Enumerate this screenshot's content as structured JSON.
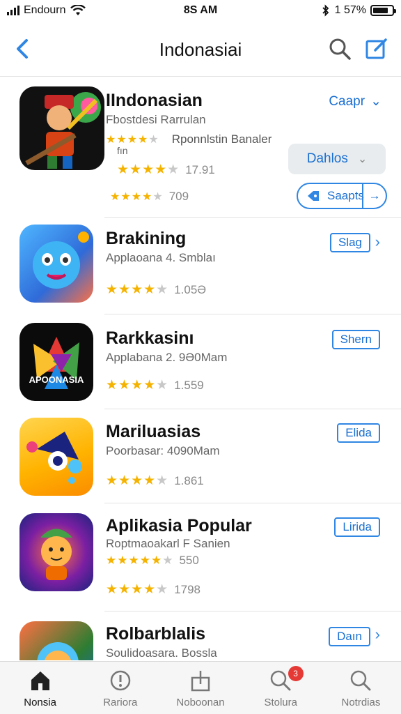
{
  "status_bar": {
    "carrier": "Endourn",
    "time": "8S AM",
    "battery": "1 57%"
  },
  "nav": {
    "title": "Indonasiai"
  },
  "apps": [
    {
      "name": "IIndonasian",
      "subtitle": "Fbostdesi Rarrulan",
      "ratings": [
        {
          "stars": 4,
          "text": "Rponnlstin Banaler"
        },
        {
          "stars": 4.5,
          "text": "17.91"
        },
        {
          "stars": 4,
          "text": "709"
        }
      ],
      "extra_line": "fın",
      "action_top": "Caapr",
      "action_mid": "Dahlos",
      "action_bottom": "Saapts"
    },
    {
      "name": "Brakining",
      "subtitle": "Applaoana 4. Smblaı",
      "rating_text": "1.05Ə",
      "stars": 4.5,
      "action": "Slag"
    },
    {
      "name": "Rarkkasinı",
      "subtitle": "Applabana 2. 9Ə0Mam",
      "rating_text": "1.559",
      "stars": 4.5,
      "action": "Shern",
      "icon_caption": "APOONASIA"
    },
    {
      "name": "Mariluasias",
      "subtitle": "Poorbasar: 4090Mam",
      "rating_text": "1.861",
      "stars": 4.5,
      "action": "Elida"
    },
    {
      "name": "Aplikasia Popular",
      "subtitle": "Roptmaoakarl F Sanien",
      "ratings": [
        {
          "stars": 4,
          "text": "550"
        },
        {
          "stars": 4.5,
          "text": "1798"
        }
      ],
      "action": "Lirida"
    },
    {
      "name": "Rolbarblalis",
      "subtitle": "Soulidoasara. Bossla",
      "action": "Daın"
    }
  ],
  "tabs": [
    {
      "label": "Nonsia",
      "icon": "home-icon"
    },
    {
      "label": "Rariora",
      "icon": "alert-icon"
    },
    {
      "label": "Noboonan",
      "icon": "share-icon"
    },
    {
      "label": "Stolura",
      "icon": "search-icon",
      "badge": "3"
    },
    {
      "label": "Notrdias",
      "icon": "search-icon"
    }
  ],
  "colors": {
    "accent": "#2f86e3",
    "star": "#f5b301",
    "badge": "#e53935"
  }
}
